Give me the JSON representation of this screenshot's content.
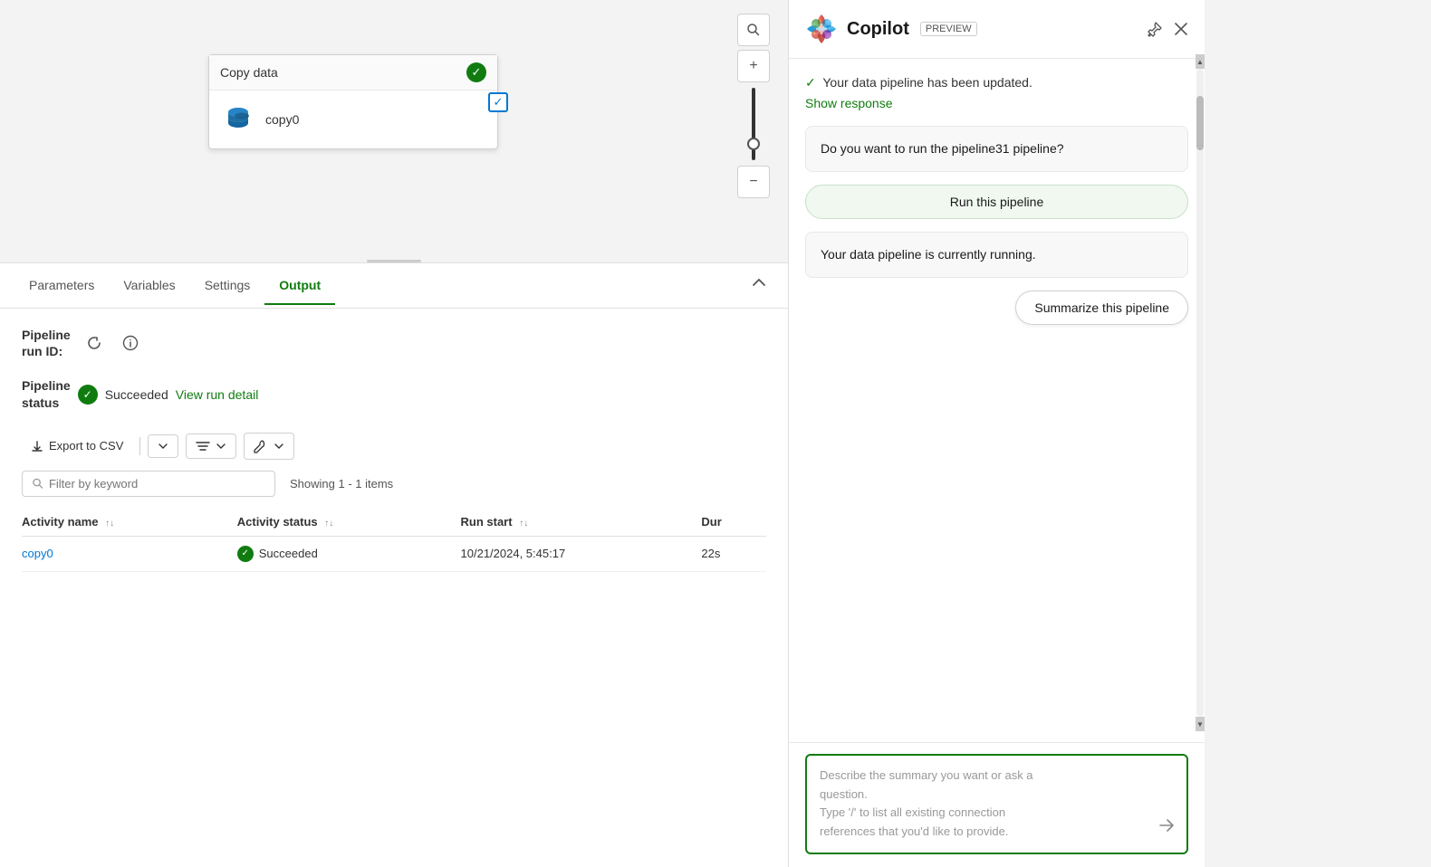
{
  "canvas": {
    "node": {
      "title": "Copy data",
      "activity_name": "copy0"
    },
    "zoom_plus": "+",
    "zoom_minus": "−",
    "search_icon": "🔍"
  },
  "tabs": {
    "items": [
      {
        "label": "Parameters",
        "active": false
      },
      {
        "label": "Variables",
        "active": false
      },
      {
        "label": "Settings",
        "active": false
      },
      {
        "label": "Output",
        "active": true
      }
    ]
  },
  "output": {
    "pipeline_run_id_label": "Pipeline\nrun ID:",
    "pipeline_status_label": "Pipeline\nstatus",
    "status_value": "Succeeded",
    "view_run_link": "View run detail",
    "export_label": "Export to CSV",
    "filter_placeholder": "Filter by keyword",
    "showing_text": "Showing 1 - 1 items",
    "table": {
      "columns": [
        {
          "label": "Activity name",
          "sortable": true
        },
        {
          "label": "Activity status",
          "sortable": true
        },
        {
          "label": "Run start",
          "sortable": true
        },
        {
          "label": "Dur"
        }
      ],
      "rows": [
        {
          "activity_name": "copy0",
          "activity_status": "Succeeded",
          "run_start": "10/21/2024, 5:45:17",
          "duration": "22s"
        }
      ]
    }
  },
  "copilot": {
    "title": "Copilot",
    "preview_label": "PREVIEW",
    "messages": [
      {
        "type": "system",
        "text": "Your data pipeline has been updated.",
        "show_response": "Show response"
      },
      {
        "type": "assistant_bubble",
        "text": "Do you want to run the pipeline31 pipeline?"
      },
      {
        "type": "suggestion",
        "text": "Run this pipeline"
      },
      {
        "type": "assistant_plain",
        "text": "Your data pipeline is currently running."
      },
      {
        "type": "summarize_btn",
        "text": "Summarize this pipeline"
      }
    ],
    "input_placeholder_line1": "Describe the summary you want or ask a",
    "input_placeholder_line2": "question.",
    "input_placeholder_line3": "Type '/' to list all existing connection",
    "input_placeholder_line4": "references that you'd like to provide."
  }
}
